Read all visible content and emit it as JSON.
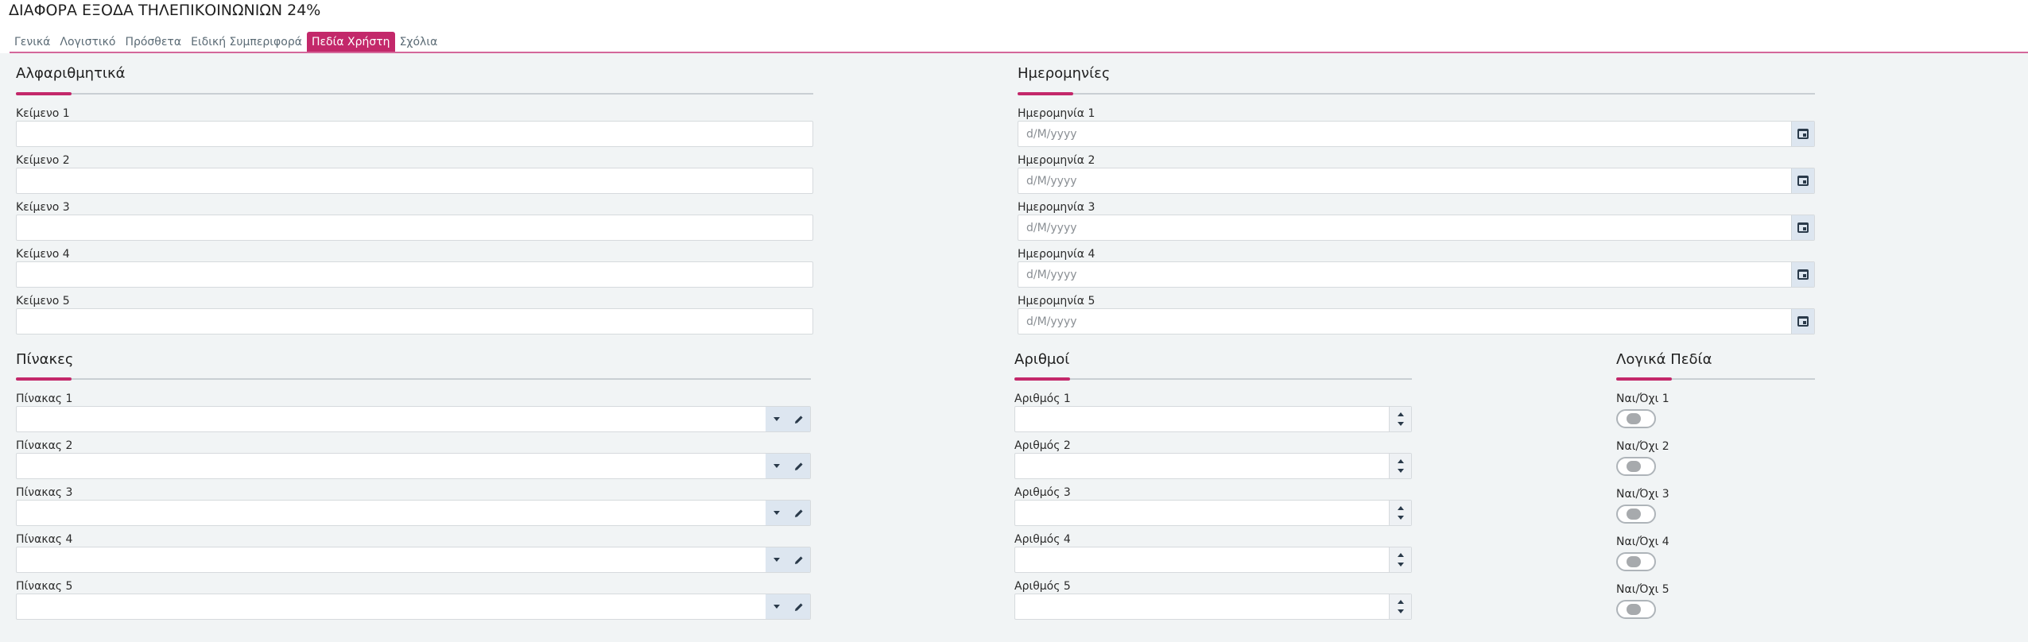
{
  "header": {
    "title": "ΔΙΑΦΟΡΑ ΕΞΟΔΑ ΤΗΛΕΠΙΚΟΙΝΩΝΙΩΝ 24%",
    "tabs": [
      {
        "label": "Γενικά"
      },
      {
        "label": "Λογιστικό"
      },
      {
        "label": "Πρόσθετα"
      },
      {
        "label": "Ειδική Συμπεριφορά"
      },
      {
        "label": "Πεδία Χρήστη"
      },
      {
        "label": "Σχόλια"
      }
    ],
    "active_tab": "Πεδία Χρήστη",
    "accent_color": "#c3286a"
  },
  "alphanumeric": {
    "title": "Αλφαριθμητικά",
    "fields": [
      {
        "label": "Κείμενο 1",
        "value": ""
      },
      {
        "label": "Κείμενο 2",
        "value": ""
      },
      {
        "label": "Κείμενο 3",
        "value": ""
      },
      {
        "label": "Κείμενο 4",
        "value": ""
      },
      {
        "label": "Κείμενο 5",
        "value": ""
      }
    ]
  },
  "dates": {
    "title": "Ημερομηνίες",
    "fields": [
      {
        "label": "Ημερομηνία 1",
        "placeholder": "d/M/yyyy"
      },
      {
        "label": "Ημερομηνία 2",
        "placeholder": "d/M/yyyy"
      },
      {
        "label": "Ημερομηνία 3",
        "placeholder": "d/M/yyyy"
      },
      {
        "label": "Ημερομηνία 4",
        "placeholder": "d/M/yyyy"
      },
      {
        "label": "Ημερομηνία 5",
        "placeholder": "d/M/yyyy"
      }
    ]
  },
  "tables": {
    "title": "Πίνακες",
    "fields": [
      {
        "label": "Πίνακας 1",
        "value": ""
      },
      {
        "label": "Πίνακας 2",
        "value": ""
      },
      {
        "label": "Πίνακας 3",
        "value": ""
      },
      {
        "label": "Πίνακας 4",
        "value": ""
      },
      {
        "label": "Πίνακας 5",
        "value": ""
      }
    ]
  },
  "numbers": {
    "title": "Αριθμοί",
    "fields": [
      {
        "label": "Αριθμός 1",
        "value": ""
      },
      {
        "label": "Αριθμός 2",
        "value": ""
      },
      {
        "label": "Αριθμός 3",
        "value": ""
      },
      {
        "label": "Αριθμός 4",
        "value": ""
      },
      {
        "label": "Αριθμός 5",
        "value": ""
      }
    ]
  },
  "booleans": {
    "title": "Λογικά Πεδία",
    "fields": [
      {
        "label": "Ναι/Όχι 1",
        "on": false
      },
      {
        "label": "Ναι/Όχι 2",
        "on": false
      },
      {
        "label": "Ναι/Όχι 3",
        "on": false
      },
      {
        "label": "Ναι/Όχι 4",
        "on": false
      },
      {
        "label": "Ναι/Όχι 5",
        "on": false
      }
    ]
  }
}
